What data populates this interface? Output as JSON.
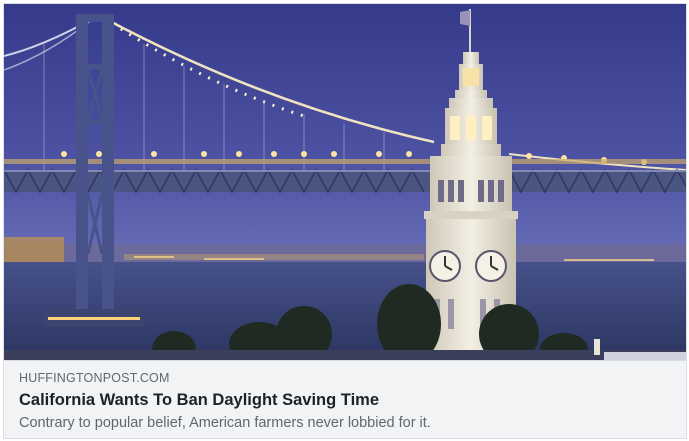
{
  "link_preview": {
    "domain": "HUFFINGTONPOST.COM",
    "title": "California Wants To Ban Daylight Saving Time",
    "description": "Contrary to popular belief, American farmers never lobbied for it."
  },
  "image": {
    "subject": "bay-bridge-and-ferry-building-clock-tower-at-dusk"
  },
  "colors": {
    "sky_top": "#3a3f8e",
    "sky_bottom": "#5a5fae",
    "water": "#3b4a7a",
    "bridge": "#4a5680",
    "tower_white": "#e8e3d6",
    "lights": "#ffe9b0",
    "meta_bg": "#f2f3f5",
    "domain_text": "#606770",
    "title_text": "#1d2129"
  }
}
